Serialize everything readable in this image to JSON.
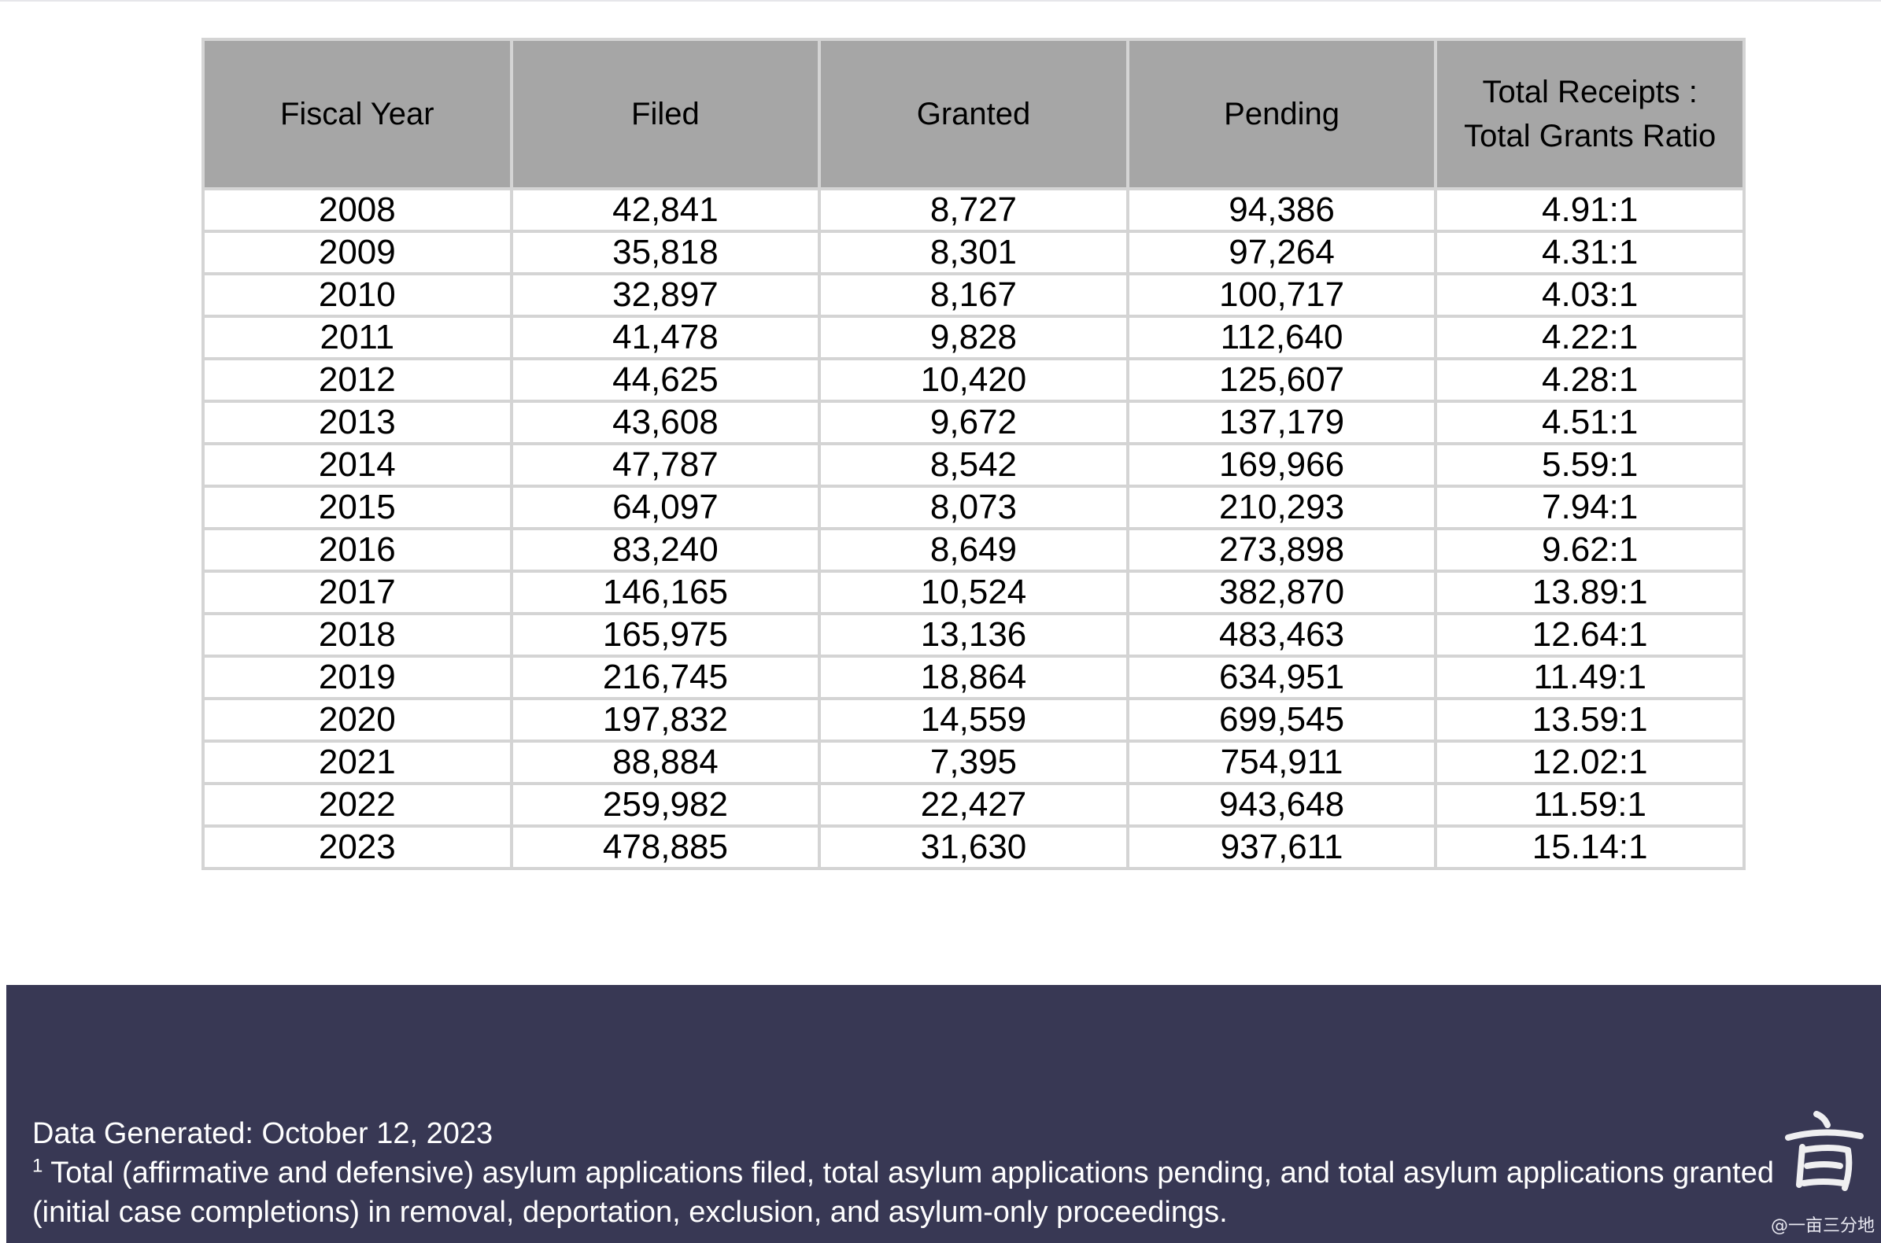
{
  "table": {
    "headers": [
      "Fiscal Year",
      "Filed",
      "Granted",
      "Pending",
      "Total Receipts :\nTotal Grants Ratio"
    ],
    "rows": [
      [
        "2008",
        "42,841",
        "8,727",
        "94,386",
        "4.91:1"
      ],
      [
        "2009",
        "35,818",
        "8,301",
        "97,264",
        "4.31:1"
      ],
      [
        "2010",
        "32,897",
        "8,167",
        "100,717",
        "4.03:1"
      ],
      [
        "2011",
        "41,478",
        "9,828",
        "112,640",
        "4.22:1"
      ],
      [
        "2012",
        "44,625",
        "10,420",
        "125,607",
        "4.28:1"
      ],
      [
        "2013",
        "43,608",
        "9,672",
        "137,179",
        "4.51:1"
      ],
      [
        "2014",
        "47,787",
        "8,542",
        "169,966",
        "5.59:1"
      ],
      [
        "2015",
        "64,097",
        "8,073",
        "210,293",
        "7.94:1"
      ],
      [
        "2016",
        "83,240",
        "8,649",
        "273,898",
        "9.62:1"
      ],
      [
        "2017",
        "146,165",
        "10,524",
        "382,870",
        "13.89:1"
      ],
      [
        "2018",
        "165,975",
        "13,136",
        "483,463",
        "12.64:1"
      ],
      [
        "2019",
        "216,745",
        "18,864",
        "634,951",
        "11.49:1"
      ],
      [
        "2020",
        "197,832",
        "14,559",
        "699,545",
        "13.59:1"
      ],
      [
        "2021",
        "88,884",
        "7,395",
        "754,911",
        "12.02:1"
      ],
      [
        "2022",
        "259,982",
        "22,427",
        "943,648",
        "11.59:1"
      ],
      [
        "2023",
        "478,885",
        "31,630",
        "937,611",
        "15.14:1"
      ]
    ]
  },
  "footer": {
    "generated": "Data Generated: October 12, 2023",
    "footnote_marker": "1",
    "footnote_line1": " Total (affirmative and defensive) asylum applications filed, total asylum applications pending, and total asylum applications granted",
    "footnote_line2": "(initial case completions) in removal, deportation, exclusion, and asylum-only proceedings."
  },
  "watermark": {
    "text": "@一亩三分地",
    "icon": "logo-stamp-icon"
  },
  "colors": {
    "header_bg": "#a6a6a6",
    "grid": "#d4d4d4",
    "footer_bg": "#383854"
  }
}
